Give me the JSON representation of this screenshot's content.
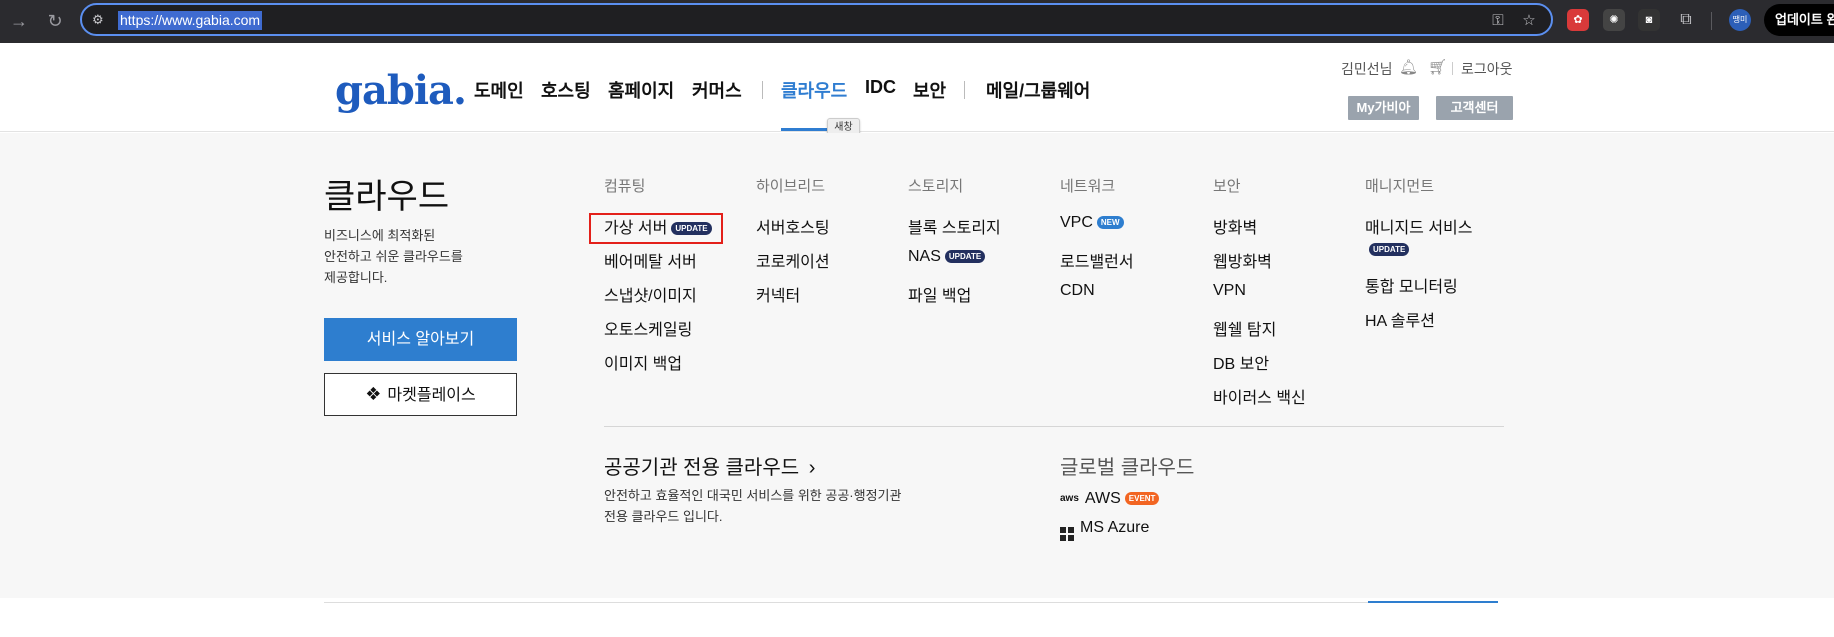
{
  "browser": {
    "url": "https://www.gabia.com",
    "profile_label": "땡미",
    "update_button": "업데이트 완"
  },
  "header": {
    "logo_text": "gabia.",
    "nav": [
      "도메인",
      "호스팅",
      "홈페이지",
      "커머스",
      "클라우드",
      "IDC",
      "보안",
      "메일/그룹웨어"
    ],
    "active_nav": "클라우드",
    "tooltip": "새창",
    "user_name": "김민선님",
    "logout": "로그아웃",
    "my_gabia": "My가비아",
    "support": "고객센터"
  },
  "mega": {
    "title": "클라우드",
    "desc_lines": [
      "비즈니스에 최적화된",
      "안전하고 쉬운 클라우드를",
      "제공합니다."
    ],
    "primary_button": "서비스 알아보기",
    "marketplace_button": "마켓플레이스",
    "columns": [
      {
        "head": "컴퓨팅",
        "items": [
          {
            "label": "가상 서버",
            "badge": "UPDATE"
          },
          {
            "label": "베어메탈 서버"
          },
          {
            "label": "스냅샷/이미지"
          },
          {
            "label": "오토스케일링"
          },
          {
            "label": "이미지 백업"
          }
        ]
      },
      {
        "head": "하이브리드",
        "items": [
          {
            "label": "서버호스팅"
          },
          {
            "label": "코로케이션"
          },
          {
            "label": "커넥터"
          }
        ]
      },
      {
        "head": "스토리지",
        "items": [
          {
            "label": "블록 스토리지"
          },
          {
            "label": "NAS",
            "badge": "UPDATE"
          },
          {
            "label": "파일 백업"
          }
        ]
      },
      {
        "head": "네트워크",
        "items": [
          {
            "label": "VPC",
            "badge": "NEW"
          },
          {
            "label": "로드밸런서"
          },
          {
            "label": "CDN"
          }
        ]
      },
      {
        "head": "보안",
        "items": [
          {
            "label": "방화벽"
          },
          {
            "label": "웹방화벽"
          },
          {
            "label": "VPN"
          },
          {
            "label": "웹쉘 탐지"
          },
          {
            "label": "DB 보안"
          },
          {
            "label": "바이러스 백신"
          }
        ]
      },
      {
        "head": "매니지먼트",
        "items": [
          {
            "label": "매니지드 서비스",
            "badge": "UPDATE"
          },
          {
            "label": "통합 모니터링"
          },
          {
            "label": "HA 솔루션"
          }
        ]
      }
    ],
    "public_cloud": {
      "title": "공공기관 전용 클라우드",
      "desc_lines": [
        "안전하고 효율적인 대국민 서비스를 위한 공공·행정기관",
        "전용 클라우드 입니다."
      ]
    },
    "global_cloud": {
      "title": "글로벌 클라우드",
      "aws_label": "AWS",
      "aws_mark": "aws",
      "aws_badge": "EVENT",
      "azure_label": "MS Azure"
    }
  },
  "colors": {
    "accent": "#2e7ecf",
    "update_badge": "#23305f",
    "event_badge": "#f26522",
    "highlight": "#e3201a"
  }
}
